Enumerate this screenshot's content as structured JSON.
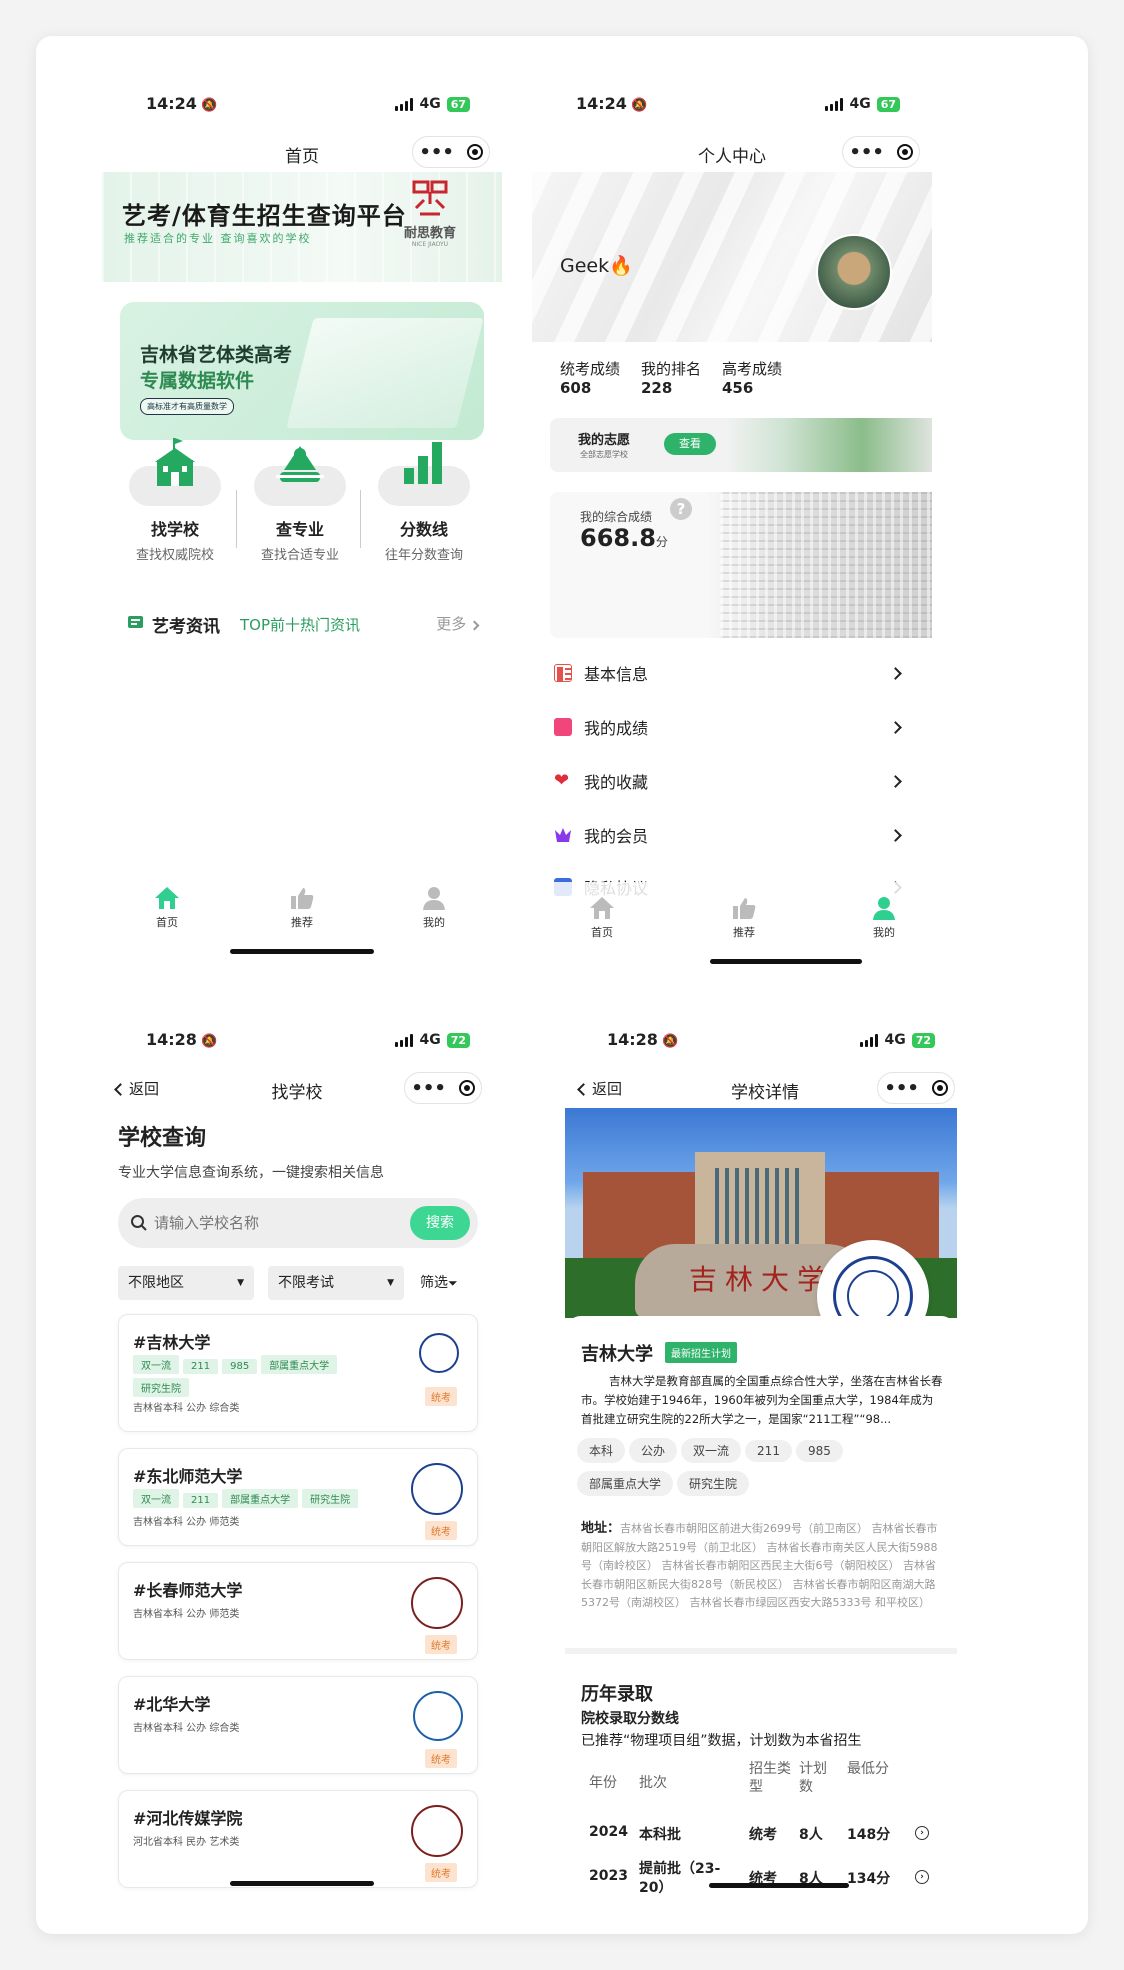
{
  "status": {
    "p1": {
      "time": "14:24",
      "net": "4G",
      "battery": "67"
    },
    "p2": {
      "time": "14:24",
      "net": "4G",
      "battery": "67"
    },
    "p3": {
      "time": "14:28",
      "net": "4G",
      "battery": "72"
    },
    "p4": {
      "time": "14:28",
      "net": "4G",
      "battery": "72"
    }
  },
  "home": {
    "title": "首页",
    "banner_title": "艺考/体育生招生查询平台",
    "banner_sub": "推荐适合的专业  查询喜欢的学校",
    "logo_text": "耐思教育",
    "logo_sub": "NICE JIAOYU",
    "promo_l1": "吉林省艺体类高考",
    "promo_l2": "专属数据软件",
    "promo_tag": "高标准才有高质量数学",
    "features": [
      {
        "title": "找学校",
        "sub": "查找权威院校"
      },
      {
        "title": "查专业",
        "sub": "查找合适专业"
      },
      {
        "title": "分数线",
        "sub": "往年分数查询"
      }
    ],
    "news_title": "艺考资讯",
    "news_sub": "TOP前十热门资讯",
    "more": "更多"
  },
  "tabs": {
    "home": "首页",
    "rec": "推荐",
    "me": "我的"
  },
  "profile": {
    "title": "个人中心",
    "name": "Geek🔥",
    "stats": [
      {
        "label": "统考成绩",
        "value": "608"
      },
      {
        "label": "我的排名",
        "value": "228"
      },
      {
        "label": "高考成绩",
        "value": "456"
      }
    ],
    "wish_title": "我的志愿",
    "wish_sub": "全部志愿学校",
    "wish_btn": "查看",
    "score_label": "我的综合成绩",
    "score_value": "668.8",
    "score_unit": "分",
    "menu": [
      "基本信息",
      "我的成绩",
      "我的收藏",
      "我的会员",
      "隐私协议"
    ]
  },
  "search": {
    "back": "返回",
    "title": "找学校",
    "heading": "学校查询",
    "desc": "专业大学信息查询系统，一键搜索相关信息",
    "placeholder": "请输入学校名称",
    "btn": "搜索",
    "filter1": "不限地区",
    "filter2": "不限考试",
    "filter3": "筛选",
    "schools": [
      {
        "name": "#吉林大学",
        "tags": [
          "双一流",
          "211",
          "985",
          "部属重点大学",
          "研究生院"
        ],
        "meta": "吉林省本科 公办 综合类",
        "badge": "统考"
      },
      {
        "name": "#东北师范大学",
        "tags": [
          "双一流",
          "211",
          "部属重点大学",
          "研究生院"
        ],
        "meta": "吉林省本科 公办 师范类",
        "badge": "统考"
      },
      {
        "name": "#长春师范大学",
        "tags": [],
        "meta": "吉林省本科 公办 师范类",
        "badge": "统考"
      },
      {
        "name": "#北华大学",
        "tags": [],
        "meta": "吉林省本科 公办 综合类",
        "badge": "统考"
      },
      {
        "name": "#河北传媒学院",
        "tags": [],
        "meta": "河北省本科 民办 艺术类",
        "badge": "统考"
      }
    ]
  },
  "detail": {
    "back": "返回",
    "title": "学校详情",
    "name": "吉林大学",
    "badge": "最新招生计划",
    "intro": "吉林大学是教育部直属的全国重点综合性大学，坐落在吉林省长春市。学校始建于1946年，1960年被列为全国重点大学，1984年成为首批建立研究生院的22所大学之一，是国家“211工程”“98...",
    "pills": [
      "本科",
      "公办",
      "双一流",
      "211",
      "985",
      "部属重点大学",
      "研究生院"
    ],
    "addr_label": "地址：",
    "addr": "吉林省长春市朝阳区前进大街2699号（前卫南区） 吉林省长春市朝阳区解放大路2519号（前卫北区） 吉林省长春市南关区人民大街5988号（南岭校区） 吉林省长春市朝阳区西民主大街6号（朝阳校区） 吉林省长春市朝阳区新民大街828号（新民校区） 吉林省长春市朝阳区南湖大路5372号（南湖校区） 吉林省长春市绿园区西安大路5333号 和平校区）",
    "hist_title": "历年录取",
    "hist_sub": "院校录取分数线",
    "hist_note": "已推荐“物理项目组”数据，计划数为本省招生",
    "cols": [
      "年份",
      "批次",
      "招生类型",
      "计划数",
      "最低分"
    ],
    "rows": [
      [
        "2024",
        "本科批",
        "统考",
        "8人",
        "148分"
      ],
      [
        "2023",
        "提前批（23-20）",
        "统考",
        "8人",
        "134分"
      ]
    ],
    "campus_sign": "吉林大学"
  }
}
